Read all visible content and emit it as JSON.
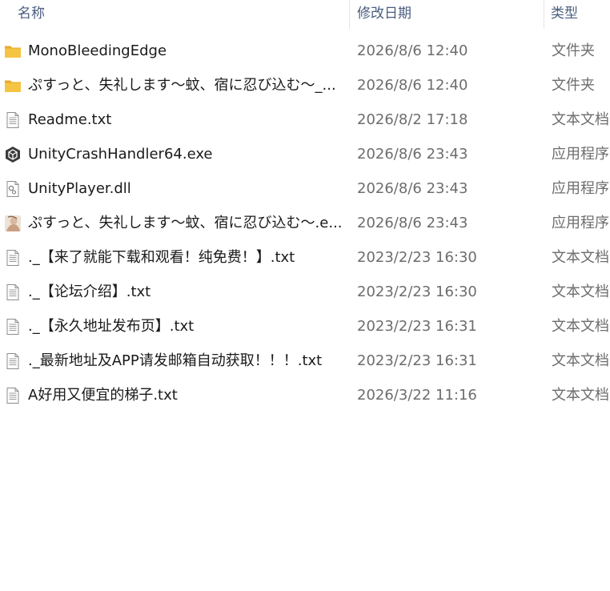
{
  "columns": {
    "name": "名称",
    "date": "修改日期",
    "type": "类型"
  },
  "files": [
    {
      "icon": "folder-icon",
      "name": "MonoBleedingEdge",
      "date": "2026/8/6 12:40",
      "type": "文件夹"
    },
    {
      "icon": "folder-icon",
      "name": "ぷすっと、失礼します～蚊、宿に忍び込む～_...",
      "date": "2026/8/6 12:40",
      "type": "文件夹"
    },
    {
      "icon": "text-file-icon",
      "name": "Readme.txt",
      "date": "2026/8/2 17:18",
      "type": "文本文档"
    },
    {
      "icon": "unity-exe-icon",
      "name": "UnityCrashHandler64.exe",
      "date": "2026/8/6 23:43",
      "type": "应用程序"
    },
    {
      "icon": "dll-file-icon",
      "name": "UnityPlayer.dll",
      "date": "2026/8/6 23:43",
      "type": "应用程序"
    },
    {
      "icon": "game-exe-icon",
      "name": "ぷすっと、失礼します～蚊、宿に忍び込む～.e...",
      "date": "2026/8/6 23:43",
      "type": "应用程序"
    },
    {
      "icon": "text-file-icon",
      "name": "._【来了就能下载和观看！纯免费！】.txt",
      "date": "2023/2/23 16:30",
      "type": "文本文档"
    },
    {
      "icon": "text-file-icon",
      "name": "._【论坛介绍】.txt",
      "date": "2023/2/23 16:30",
      "type": "文本文档"
    },
    {
      "icon": "text-file-icon",
      "name": "._【永久地址发布页】.txt",
      "date": "2023/2/23 16:31",
      "type": "文本文档"
    },
    {
      "icon": "text-file-icon",
      "name": "._最新地址及APP请发邮箱自动获取！！！.txt",
      "date": "2023/2/23 16:31",
      "type": "文本文档"
    },
    {
      "icon": "text-file-icon",
      "name": "A好用又便宜的梯子.txt",
      "date": "2026/3/22 11:16",
      "type": "文本文档"
    }
  ],
  "colors": {
    "folder": "#f4c24e",
    "header_text": "#4a5d7e",
    "name_text": "#1a1a1a",
    "meta_text": "#6d6d6d"
  }
}
